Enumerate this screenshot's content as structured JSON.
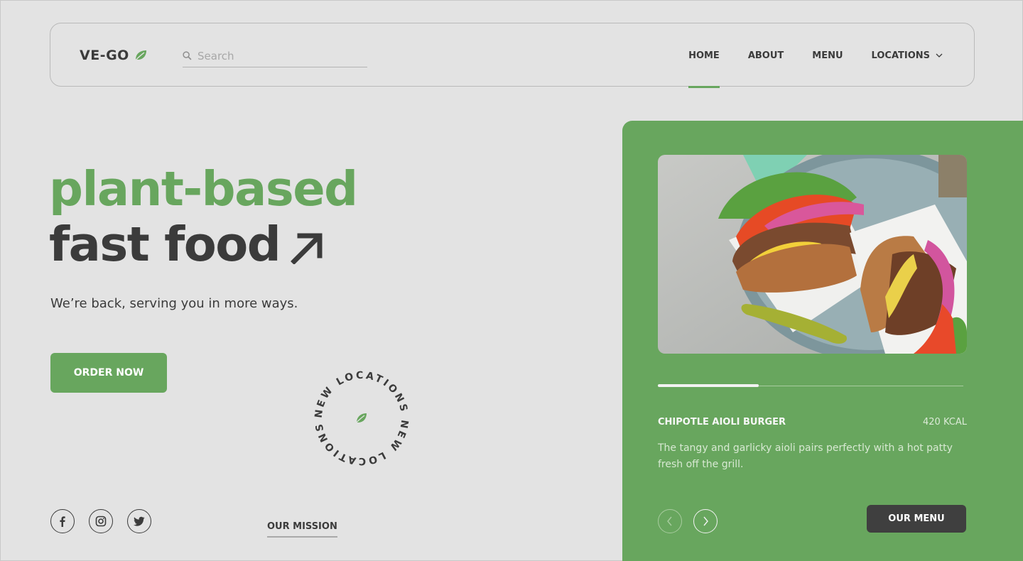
{
  "header": {
    "logo_text": "VE-GO",
    "search_placeholder": "Search",
    "nav": [
      {
        "label": "HOME",
        "active": true
      },
      {
        "label": "ABOUT"
      },
      {
        "label": "MENU"
      },
      {
        "label": "LOCATIONS",
        "has_dropdown": true
      }
    ]
  },
  "hero": {
    "title_line1": "plant-based",
    "title_line2": "fast food",
    "subtitle": "We’re back, serving you in more ways.",
    "order_button": "ORDER NOW"
  },
  "badge": {
    "circular_text": "NEW LOCATIONS NEW LOCATIONS "
  },
  "footer": {
    "socials": [
      "facebook-icon",
      "instagram-icon",
      "twitter-icon"
    ],
    "mission_link": "OUR MISSION"
  },
  "card": {
    "slider_progress": 0.33,
    "item_name": "CHIPOTLE AIOLI BURGER",
    "item_kcal": "420 KCAL",
    "item_description": "The tangy and garlicky aioli pairs perfectly with a hot patty fresh off the grill.",
    "menu_button": "OUR MENU"
  },
  "colors": {
    "accent": "#68a65e",
    "background": "#e3e3e3",
    "text_dark": "#3b3b3b",
    "button_dark": "#3f3f3f"
  }
}
